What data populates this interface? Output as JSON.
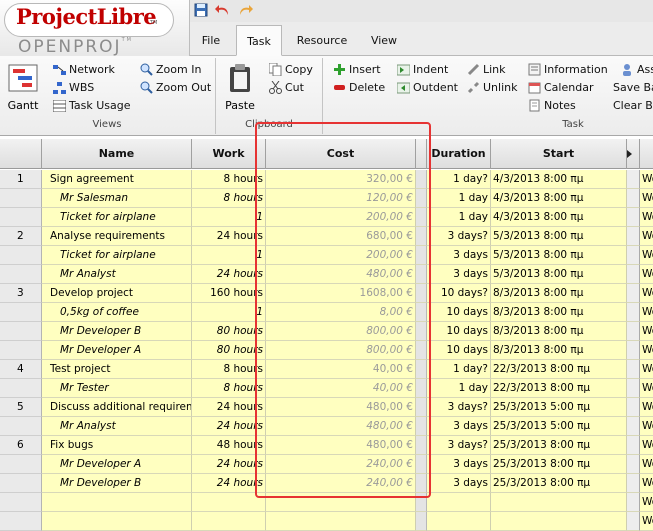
{
  "brand": {
    "name": "ProjectLibre",
    "tm": "TM",
    "sub_a": "OPEN",
    "sub_b": "PROJ",
    "sub_tm": "TM"
  },
  "menu_tabs": [
    "File",
    "Task",
    "Resource",
    "View"
  ],
  "active_tab": "Task",
  "ribbon": {
    "views": {
      "gantt": "Gantt",
      "network": "Network",
      "wbs": "WBS",
      "task_usage": "Task Usage",
      "zoom_in": "Zoom In",
      "zoom_out": "Zoom Out",
      "label": "Views"
    },
    "clipboard": {
      "paste": "Paste",
      "copy": "Copy",
      "cut": "Cut",
      "label": "Clipboard"
    },
    "task": {
      "insert": "Insert",
      "delete": "Delete",
      "indent": "Indent",
      "outdent": "Outdent",
      "link": "Link",
      "unlink": "Unlink",
      "information": "Information",
      "calendar": "Calendar",
      "notes": "Notes",
      "assign": "Assi",
      "save_baseline": "Save Ba",
      "clear_baseline": "Clear Ba",
      "label": "Task"
    }
  },
  "columns": {
    "name": "Name",
    "work": "Work",
    "cost": "Cost",
    "duration": "Duration",
    "start": "Start"
  },
  "rows": [
    {
      "id": "1",
      "name": "Sign agreement",
      "work": "8 hours",
      "cost": "320,00 €",
      "duration": "1 day?",
      "start": "4/3/2013 8:00 πμ",
      "cal": "Wo",
      "italic": false
    },
    {
      "id": "",
      "name": "Mr Salesman",
      "work": "8 hours",
      "cost": "120,00 €",
      "duration": "1 day",
      "start": "4/3/2013 8:00 πμ",
      "cal": "Wo",
      "italic": true
    },
    {
      "id": "",
      "name": "Ticket for airplane",
      "work": "1",
      "cost": "200,00 €",
      "duration": "1 day",
      "start": "4/3/2013 8:00 πμ",
      "cal": "Wo",
      "italic": true
    },
    {
      "id": "2",
      "name": "Analyse requirements",
      "work": "24 hours",
      "cost": "680,00 €",
      "duration": "3 days?",
      "start": "5/3/2013 8:00 πμ",
      "cal": "Wo",
      "italic": false
    },
    {
      "id": "",
      "name": "Ticket for airplane",
      "work": "1",
      "cost": "200,00 €",
      "duration": "3 days",
      "start": "5/3/2013 8:00 πμ",
      "cal": "Wo",
      "italic": true
    },
    {
      "id": "",
      "name": "Mr Analyst",
      "work": "24 hours",
      "cost": "480,00 €",
      "duration": "3 days",
      "start": "5/3/2013 8:00 πμ",
      "cal": "Wo",
      "italic": true
    },
    {
      "id": "3",
      "name": "Develop project",
      "work": "160 hours",
      "cost": "1608,00 €",
      "duration": "10 days?",
      "start": "8/3/2013 8:00 πμ",
      "cal": "Wo",
      "italic": false
    },
    {
      "id": "",
      "name": "0,5kg of coffee",
      "work": "1",
      "cost": "8,00 €",
      "duration": "10 days",
      "start": "8/3/2013 8:00 πμ",
      "cal": "Wo",
      "italic": true
    },
    {
      "id": "",
      "name": "Mr Developer B",
      "work": "80 hours",
      "cost": "800,00 €",
      "duration": "10 days",
      "start": "8/3/2013 8:00 πμ",
      "cal": "Wo",
      "italic": true
    },
    {
      "id": "",
      "name": "Mr Developer A",
      "work": "80 hours",
      "cost": "800,00 €",
      "duration": "10 days",
      "start": "8/3/2013 8:00 πμ",
      "cal": "Wo",
      "italic": true
    },
    {
      "id": "4",
      "name": "Test project",
      "work": "8 hours",
      "cost": "40,00 €",
      "duration": "1 day?",
      "start": "22/3/2013 8:00 πμ",
      "cal": "Wo",
      "italic": false
    },
    {
      "id": "",
      "name": "Mr Tester",
      "work": "8 hours",
      "cost": "40,00 €",
      "duration": "1 day",
      "start": "22/3/2013 8:00 πμ",
      "cal": "Wo",
      "italic": true
    },
    {
      "id": "5",
      "name": "Discuss additional requiremer",
      "work": "24 hours",
      "cost": "480,00 €",
      "duration": "3 days?",
      "start": "25/3/2013 5:00 πμ",
      "cal": "Wo",
      "italic": false
    },
    {
      "id": "",
      "name": "Mr Analyst",
      "work": "24 hours",
      "cost": "480,00 €",
      "duration": "3 days",
      "start": "25/3/2013 5:00 πμ",
      "cal": "Wo",
      "italic": true
    },
    {
      "id": "6",
      "name": "Fix bugs",
      "work": "48 hours",
      "cost": "480,00 €",
      "duration": "3 days?",
      "start": "25/3/2013 8:00 πμ",
      "cal": "Wo",
      "italic": false
    },
    {
      "id": "",
      "name": "Mr Developer A",
      "work": "24 hours",
      "cost": "240,00 €",
      "duration": "3 days",
      "start": "25/3/2013 8:00 πμ",
      "cal": "Wo",
      "italic": true
    },
    {
      "id": "",
      "name": "Mr Developer B",
      "work": "24 hours",
      "cost": "240,00 €",
      "duration": "3 days",
      "start": "25/3/2013 8:00 πμ",
      "cal": "Wo",
      "italic": true
    },
    {
      "id": "",
      "name": "",
      "work": "",
      "cost": "",
      "duration": "",
      "start": "",
      "cal": "Wo",
      "italic": false
    },
    {
      "id": "",
      "name": "",
      "work": "",
      "cost": "",
      "duration": "",
      "start": "",
      "cal": "Wo",
      "italic": false
    }
  ],
  "colors": {
    "row_bg": "#ffffc0",
    "highlight": "#e63333",
    "logo_red": "#c00000"
  }
}
